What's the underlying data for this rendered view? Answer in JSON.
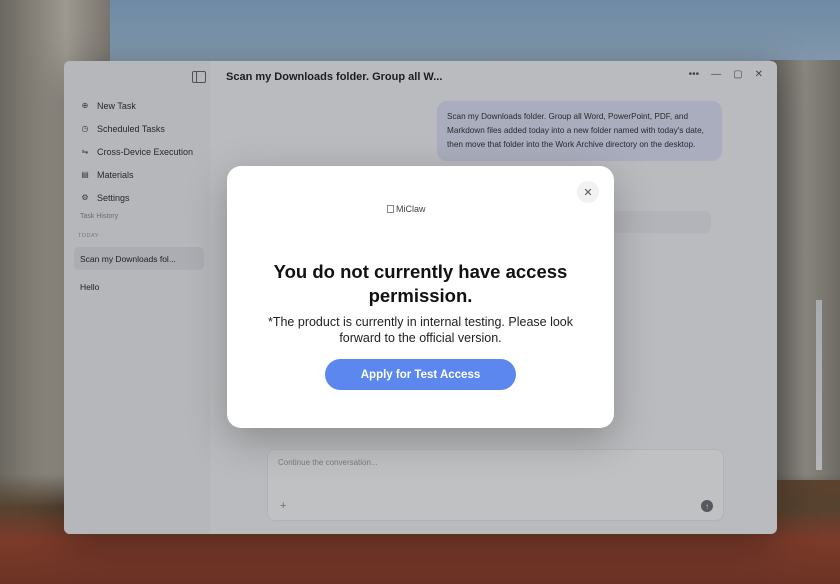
{
  "sidebar": {
    "items": [
      {
        "icon": "plus-circle-icon",
        "glyph": "⊕",
        "label": "New Task"
      },
      {
        "icon": "clock-icon",
        "glyph": "◷",
        "label": "Scheduled Tasks"
      },
      {
        "icon": "devices-icon",
        "glyph": "⇋",
        "label": "Cross-Device Execution"
      },
      {
        "icon": "document-icon",
        "glyph": "▤",
        "label": "Materials"
      },
      {
        "icon": "gear-icon",
        "glyph": "⚙",
        "label": "Settings"
      }
    ],
    "history_title": "Task History",
    "today_label": "TODAY",
    "history": [
      {
        "label": "Scan my Downloads fol..."
      },
      {
        "label": "Hello"
      }
    ]
  },
  "chat": {
    "title": "Scan my Downloads folder. Group all W...",
    "user_message": "Scan my Downloads folder. Group all Word, PowerPoint, PDF, and Markdown files added today into a new folder named with today's date, then move that folder into the Work Archive directory on the desktop.",
    "composer_placeholder": "Continue the conversation..."
  },
  "window_controls": {
    "more": "•••",
    "minimize": "—",
    "maximize": "▢",
    "close": "✕"
  },
  "modal": {
    "logo_alt": "MiClaw",
    "title": "You do not currently have access permission.",
    "subtitle": "*The product is currently in internal testing. Please look forward to the official version.",
    "button": "Apply for Test Access",
    "close": "✕"
  },
  "colors": {
    "accent": "#5b87ef",
    "bubble": "#dfe3f7"
  }
}
